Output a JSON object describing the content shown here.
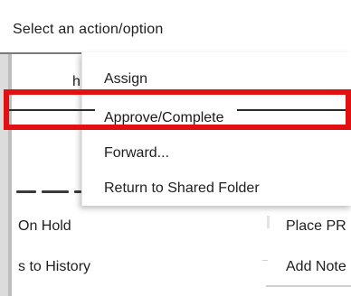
{
  "header": {
    "title": "Select an action/option"
  },
  "menu": {
    "items": [
      {
        "label": "Assign"
      },
      {
        "label": "Approve/Complete"
      },
      {
        "label": "Forward..."
      },
      {
        "label": "Return to Shared Folder"
      }
    ]
  },
  "actions": {
    "on_hold": "On Hold",
    "history": "s to History",
    "place_pr": "Place PR",
    "add_note": "Add Note"
  },
  "colors": {
    "highlight": "#e21010",
    "text": "#202020",
    "background": "#ffffff"
  }
}
